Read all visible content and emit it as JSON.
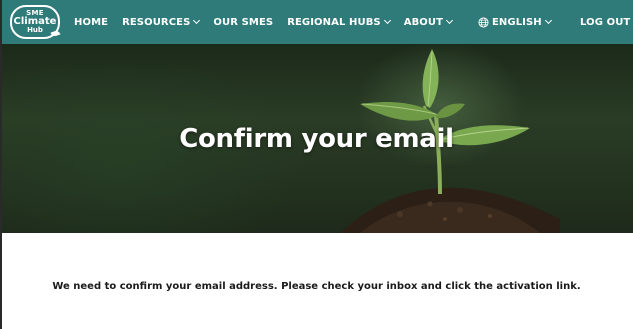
{
  "logo": {
    "line1": "SME",
    "line2": "Climate",
    "line3": "Hub"
  },
  "nav": {
    "home": "HOME",
    "resources": "RESOURCES",
    "our_smes": "OUR SMES",
    "regional_hubs": "REGIONAL HUBS",
    "about": "ABOUT",
    "language": "ENGLISH",
    "logout": "LOG OUT"
  },
  "hero": {
    "title": "Confirm your email"
  },
  "message": "We need to confirm your email address. Please check your inbox and click the activation link.",
  "colors": {
    "nav_bg": "#2e7b79",
    "text_white": "#ffffff",
    "body_text": "#1a1a1a"
  }
}
